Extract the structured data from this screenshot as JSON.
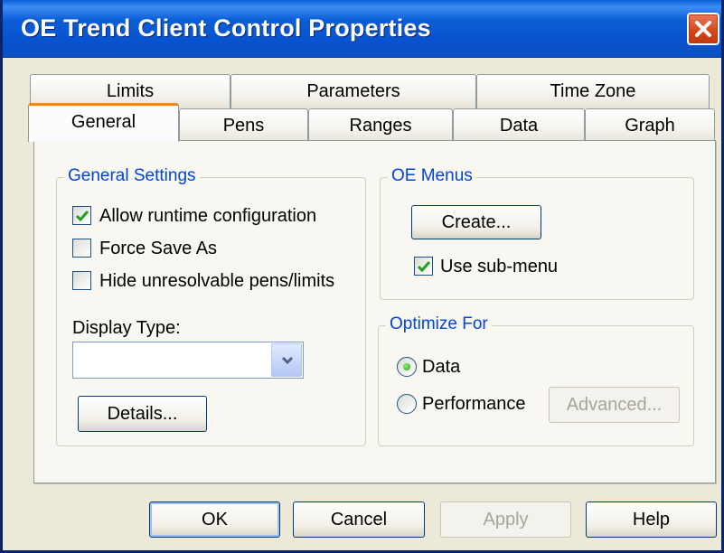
{
  "window": {
    "title": "OE Trend Client Control Properties"
  },
  "tabs_top": [
    {
      "label": "Limits"
    },
    {
      "label": "Parameters"
    },
    {
      "label": "Time Zone"
    }
  ],
  "tabs_bottom": [
    {
      "label": "General",
      "active": true
    },
    {
      "label": "Pens"
    },
    {
      "label": "Ranges"
    },
    {
      "label": "Data"
    },
    {
      "label": "Graph"
    }
  ],
  "general_settings": {
    "title": "General Settings",
    "allow_runtime": {
      "label": "Allow runtime configuration",
      "checked": true
    },
    "force_save_as": {
      "label": "Force Save As",
      "checked": false
    },
    "hide_unresolvable": {
      "label": "Hide unresolvable pens/limits",
      "checked": false
    },
    "display_type_label": "Display Type:",
    "display_type_value": "",
    "details_button": "Details..."
  },
  "oe_menus": {
    "title": "OE Menus",
    "create_button": "Create...",
    "use_submenu": {
      "label": "Use sub-menu",
      "checked": true
    }
  },
  "optimize_for": {
    "title": "Optimize For",
    "data_option": {
      "label": "Data",
      "selected": true
    },
    "performance_option": {
      "label": "Performance",
      "selected": false
    },
    "advanced_button": "Advanced..."
  },
  "footer": {
    "ok": "OK",
    "cancel": "Cancel",
    "apply": "Apply",
    "help": "Help"
  },
  "colors": {
    "title_bar": "#0b5ed6",
    "group_title": "#0046d5",
    "active_tab_accent": "#e68b2c",
    "check_mark": "#21a121"
  }
}
